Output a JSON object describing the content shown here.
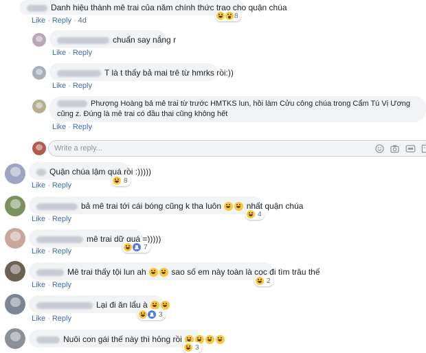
{
  "comments": [
    {
      "id": "c1",
      "text": "Danh hiệu thành mê trai của năm chính thức trao cho quận chúa",
      "actions": {
        "like": "Like",
        "reply": "Reply",
        "time": "4d"
      },
      "reaction_count": "8",
      "more": "···"
    },
    {
      "id": "r1",
      "text": "chuẩn say nắng r",
      "actions": {
        "like": "Like",
        "reply": "Reply"
      }
    },
    {
      "id": "r2",
      "text": "T là t thấy bả mai trê từ hmrks rồi:))",
      "actions": {
        "like": "Like",
        "reply": "Reply"
      }
    },
    {
      "id": "r3",
      "text": "Phượng Hoàng bả mê trai từ trước HMTKS lun, hồi làm Cửu công chúa trong Cẩm Tú Vị Ương cũng z. Đúng là mê trai có đầu thai cũng không hết",
      "actions": {
        "like": "Like",
        "reply": "Reply"
      }
    },
    {
      "id": "c2",
      "text": "Quận chúa lậm quá rồi :)))))",
      "actions": {
        "like": "Like",
        "reply": "Reply"
      },
      "reaction_count": "8"
    },
    {
      "id": "c3",
      "text_a": "bả mê trai tới cái bóng cũng k tha luôn",
      "text_b": "nhất quận chúa",
      "actions": {
        "like": "Like",
        "reply": "Reply"
      },
      "reaction_count": "4"
    },
    {
      "id": "c4",
      "text": "mê trai dữ quá =)))))",
      "actions": {
        "like": "Like",
        "reply": "Reply"
      },
      "reaction_count": "7"
    },
    {
      "id": "c5",
      "text_a": "Mê trai thấy tội lun ah",
      "text_b": "sao số em này toàn là cọc đi tìm trâu thế",
      "actions": {
        "like": "Like",
        "reply": "Reply"
      },
      "reaction_count": "2"
    },
    {
      "id": "c6",
      "text": "Lại đi ăn lẩu à",
      "actions": {
        "like": "Like",
        "reply": "Reply"
      },
      "reaction_count": "3"
    },
    {
      "id": "c7",
      "text": "Nuôi con gái thế này thì hỏng rồi",
      "reaction_count": "3"
    }
  ],
  "reply_box": {
    "placeholder": "Write a reply..."
  },
  "colors": {
    "link": "#4267b2",
    "bubble": "#f2f3f5",
    "meta": "#606770",
    "haha": "#f7c73d",
    "like": "#4e7af0"
  },
  "icons": [
    "smiley-icon",
    "camera-icon",
    "gif-icon",
    "sticker-icon",
    "haha-reaction-icon",
    "like-reaction-icon",
    "wow-reaction-icon"
  ]
}
